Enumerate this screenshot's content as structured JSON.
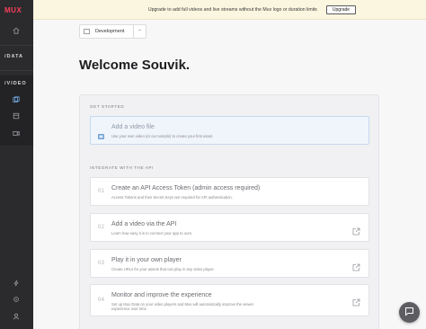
{
  "nav": {
    "logo": "MUX",
    "data_label": "/DATA",
    "video_label": "/VIDEO",
    "icons": [
      "home-icon",
      "video-assets-icon",
      "live-streams-icon",
      "upload-icon",
      "activity-icon",
      "settings-icon",
      "user-icon"
    ]
  },
  "banner": {
    "text": "Upgrade to add full videos and live streams without the Mux logo or duration limits",
    "button": "Upgrade"
  },
  "env": {
    "label": "Development"
  },
  "main": {
    "welcome": "Welcome Souvik."
  },
  "get_started": {
    "heading": "GET STARTED",
    "item": {
      "title": "Add a video file",
      "desc": "Use your own video (or our sample) to create your first asset."
    }
  },
  "api": {
    "heading": "INTEGRATE WITH THE API",
    "items": [
      {
        "num": "01",
        "title": "Create an API Access Token (admin access required)",
        "desc": "Access Tokens and their Secret Keys are required for API authentication."
      },
      {
        "num": "02",
        "title": "Add a video via the API",
        "desc": "Learn how easy it is to connect your app to ours."
      },
      {
        "num": "03",
        "title": "Play it in your own player",
        "desc": "Create URLs for your assets that can play in any video player."
      },
      {
        "num": "04",
        "title": "Monitor and improve the experience",
        "desc": "Set up Mux Data on your video players and Mux will automatically improve the viewer experience over time."
      }
    ]
  },
  "colors": {
    "brand": "#fa3f5b",
    "nav_bg": "#2b2b2e",
    "banner_bg": "#fbf6df",
    "accent_blue": "#6fa3d8"
  }
}
